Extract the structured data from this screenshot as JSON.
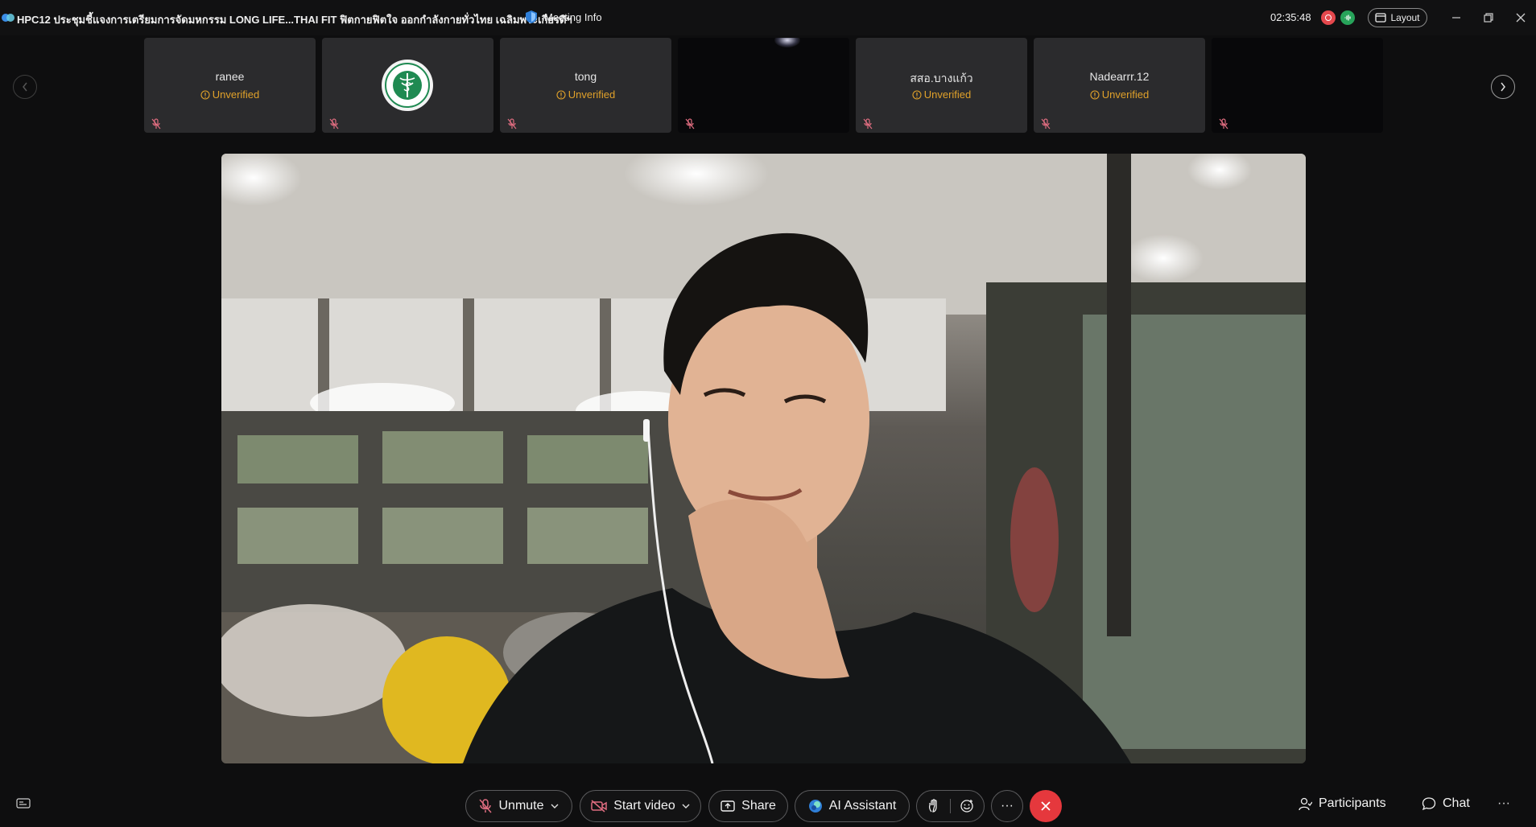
{
  "titlebar": {
    "title": "HPC12 ประชุมชี้แจงการเตรียมการจัดมหกรรม LONG LIFE...THAI FIT ฟิตกายฟิตใจ ออกกำลังกายทั่วไทย เฉลิมพระเกียรติฯ",
    "meeting_info_label": "Meeting Info",
    "clock": "02:35:48",
    "layout_label": "Layout"
  },
  "participants": [
    {
      "name": "ranee",
      "status": "Unverified",
      "kind": "name"
    },
    {
      "name": "",
      "status": "",
      "kind": "logo"
    },
    {
      "name": "tong",
      "status": "Unverified",
      "kind": "name"
    },
    {
      "name": "",
      "status": "",
      "kind": "video-dark"
    },
    {
      "name": "สสอ.บางแก้ว",
      "status": "Unverified",
      "kind": "name"
    },
    {
      "name": "Nadearrr.12",
      "status": "Unverified",
      "kind": "name"
    },
    {
      "name": "",
      "status": "",
      "kind": "video-dark"
    }
  ],
  "controls": {
    "unmute_label": "Unmute",
    "start_video_label": "Start video",
    "share_label": "Share",
    "ai_assistant_label": "AI Assistant",
    "more_label": "···",
    "participants_label": "Participants",
    "chat_label": "Chat",
    "more_right_label": "···"
  },
  "colors": {
    "accent_unverified": "#e0a12a",
    "end_call": "#e5383d",
    "mute_icon": "#e06d80",
    "background": "#0e0e0f",
    "tile": "#2b2b2d"
  },
  "icons": [
    "webex-logo",
    "shield-icon",
    "layout-icon",
    "minimize-icon",
    "restore-icon",
    "close-icon",
    "chevron-left-icon",
    "chevron-right-icon",
    "mic-off-icon",
    "video-off-icon",
    "share-icon",
    "ai-assistant-icon",
    "raise-hand-icon",
    "reaction-icon",
    "end-call-icon",
    "participants-icon",
    "chat-icon",
    "captions-icon"
  ]
}
